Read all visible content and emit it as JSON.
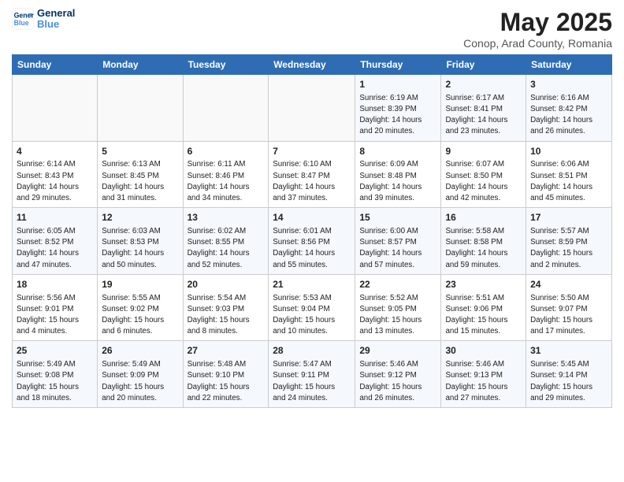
{
  "header": {
    "logo_line1": "General",
    "logo_line2": "Blue",
    "title": "May 2025",
    "subtitle": "Conop, Arad County, Romania"
  },
  "weekdays": [
    "Sunday",
    "Monday",
    "Tuesday",
    "Wednesday",
    "Thursday",
    "Friday",
    "Saturday"
  ],
  "weeks": [
    [
      {
        "day": "",
        "info": ""
      },
      {
        "day": "",
        "info": ""
      },
      {
        "day": "",
        "info": ""
      },
      {
        "day": "",
        "info": ""
      },
      {
        "day": "1",
        "info": "Sunrise: 6:19 AM\nSunset: 8:39 PM\nDaylight: 14 hours\nand 20 minutes."
      },
      {
        "day": "2",
        "info": "Sunrise: 6:17 AM\nSunset: 8:41 PM\nDaylight: 14 hours\nand 23 minutes."
      },
      {
        "day": "3",
        "info": "Sunrise: 6:16 AM\nSunset: 8:42 PM\nDaylight: 14 hours\nand 26 minutes."
      }
    ],
    [
      {
        "day": "4",
        "info": "Sunrise: 6:14 AM\nSunset: 8:43 PM\nDaylight: 14 hours\nand 29 minutes."
      },
      {
        "day": "5",
        "info": "Sunrise: 6:13 AM\nSunset: 8:45 PM\nDaylight: 14 hours\nand 31 minutes."
      },
      {
        "day": "6",
        "info": "Sunrise: 6:11 AM\nSunset: 8:46 PM\nDaylight: 14 hours\nand 34 minutes."
      },
      {
        "day": "7",
        "info": "Sunrise: 6:10 AM\nSunset: 8:47 PM\nDaylight: 14 hours\nand 37 minutes."
      },
      {
        "day": "8",
        "info": "Sunrise: 6:09 AM\nSunset: 8:48 PM\nDaylight: 14 hours\nand 39 minutes."
      },
      {
        "day": "9",
        "info": "Sunrise: 6:07 AM\nSunset: 8:50 PM\nDaylight: 14 hours\nand 42 minutes."
      },
      {
        "day": "10",
        "info": "Sunrise: 6:06 AM\nSunset: 8:51 PM\nDaylight: 14 hours\nand 45 minutes."
      }
    ],
    [
      {
        "day": "11",
        "info": "Sunrise: 6:05 AM\nSunset: 8:52 PM\nDaylight: 14 hours\nand 47 minutes."
      },
      {
        "day": "12",
        "info": "Sunrise: 6:03 AM\nSunset: 8:53 PM\nDaylight: 14 hours\nand 50 minutes."
      },
      {
        "day": "13",
        "info": "Sunrise: 6:02 AM\nSunset: 8:55 PM\nDaylight: 14 hours\nand 52 minutes."
      },
      {
        "day": "14",
        "info": "Sunrise: 6:01 AM\nSunset: 8:56 PM\nDaylight: 14 hours\nand 55 minutes."
      },
      {
        "day": "15",
        "info": "Sunrise: 6:00 AM\nSunset: 8:57 PM\nDaylight: 14 hours\nand 57 minutes."
      },
      {
        "day": "16",
        "info": "Sunrise: 5:58 AM\nSunset: 8:58 PM\nDaylight: 14 hours\nand 59 minutes."
      },
      {
        "day": "17",
        "info": "Sunrise: 5:57 AM\nSunset: 8:59 PM\nDaylight: 15 hours\nand 2 minutes."
      }
    ],
    [
      {
        "day": "18",
        "info": "Sunrise: 5:56 AM\nSunset: 9:01 PM\nDaylight: 15 hours\nand 4 minutes."
      },
      {
        "day": "19",
        "info": "Sunrise: 5:55 AM\nSunset: 9:02 PM\nDaylight: 15 hours\nand 6 minutes."
      },
      {
        "day": "20",
        "info": "Sunrise: 5:54 AM\nSunset: 9:03 PM\nDaylight: 15 hours\nand 8 minutes."
      },
      {
        "day": "21",
        "info": "Sunrise: 5:53 AM\nSunset: 9:04 PM\nDaylight: 15 hours\nand 10 minutes."
      },
      {
        "day": "22",
        "info": "Sunrise: 5:52 AM\nSunset: 9:05 PM\nDaylight: 15 hours\nand 13 minutes."
      },
      {
        "day": "23",
        "info": "Sunrise: 5:51 AM\nSunset: 9:06 PM\nDaylight: 15 hours\nand 15 minutes."
      },
      {
        "day": "24",
        "info": "Sunrise: 5:50 AM\nSunset: 9:07 PM\nDaylight: 15 hours\nand 17 minutes."
      }
    ],
    [
      {
        "day": "25",
        "info": "Sunrise: 5:49 AM\nSunset: 9:08 PM\nDaylight: 15 hours\nand 18 minutes."
      },
      {
        "day": "26",
        "info": "Sunrise: 5:49 AM\nSunset: 9:09 PM\nDaylight: 15 hours\nand 20 minutes."
      },
      {
        "day": "27",
        "info": "Sunrise: 5:48 AM\nSunset: 9:10 PM\nDaylight: 15 hours\nand 22 minutes."
      },
      {
        "day": "28",
        "info": "Sunrise: 5:47 AM\nSunset: 9:11 PM\nDaylight: 15 hours\nand 24 minutes."
      },
      {
        "day": "29",
        "info": "Sunrise: 5:46 AM\nSunset: 9:12 PM\nDaylight: 15 hours\nand 26 minutes."
      },
      {
        "day": "30",
        "info": "Sunrise: 5:46 AM\nSunset: 9:13 PM\nDaylight: 15 hours\nand 27 minutes."
      },
      {
        "day": "31",
        "info": "Sunrise: 5:45 AM\nSunset: 9:14 PM\nDaylight: 15 hours\nand 29 minutes."
      }
    ]
  ]
}
